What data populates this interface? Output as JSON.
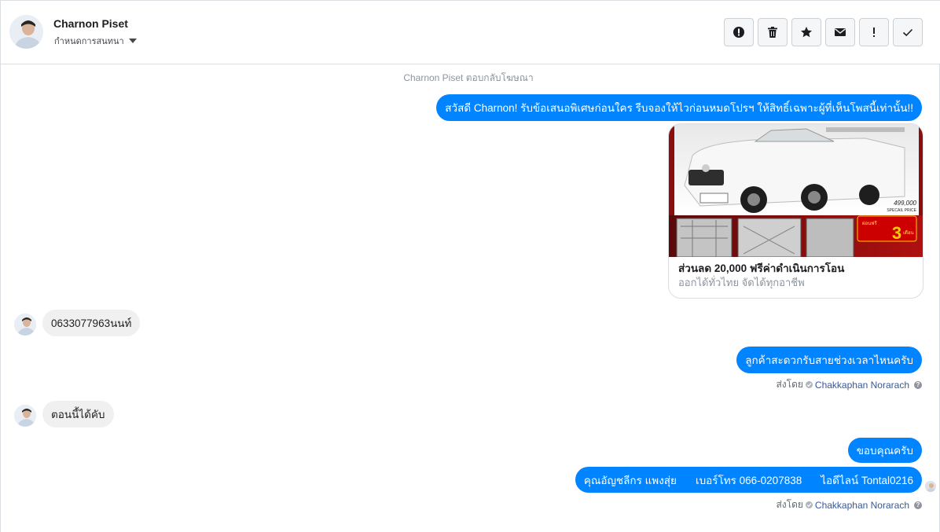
{
  "contact": {
    "name": "Charnon Piset",
    "assign_label": "กำหนดการสนทนา"
  },
  "actions": [
    {
      "icon": "spam-icon"
    },
    {
      "icon": "trash-icon"
    },
    {
      "icon": "star-icon"
    },
    {
      "icon": "mail-icon"
    },
    {
      "icon": "exclamation-icon"
    },
    {
      "icon": "check-icon"
    }
  ],
  "conversation": {
    "system_line": "Charnon Piset ตอบกลับโฆษณา",
    "messages": {
      "greeting": "สวัสดี Charnon! รับข้อเสนอพิเศษก่อนใคร รีบจองให้ไวก่อนหมดโปรฯ ให้สิทธิ์เฉพาะผู้ที่เห็นโพสนี้เท่านั้น!!",
      "ad": {
        "title": "ส่วนลด 20,000 ฟรีค่าดำเนินการโอน",
        "description": "ออกได้ทั่วไทย จัดได้ทุกอาชีพ",
        "price_text": "499,000",
        "price_caption": "SPECAIL PRICE",
        "promo_big": "3",
        "promo_word1": "ผ่อนฟรี",
        "promo_word2": "เดือน"
      },
      "customer_phone": "0633077963นนท์",
      "agent_question": "ลูกค้าสะดวกรับสายช่วงเวลาไหนครับ",
      "customer_reply": "ตอนนี้ได้คับ",
      "agent_thanks": "ขอบคุณครับ",
      "agent_signature": {
        "name": "คุณอัญชลีกร แพงสุ่ย",
        "phone": "เบอร์โทร 066-0207838",
        "line": "ไอดีไลน์ Tontal0216"
      }
    },
    "sent_by": {
      "prefix": "ส่งโดย",
      "agent": "Chakkaphan Norarach"
    }
  },
  "colors": {
    "outgoing": "#0084ff",
    "incoming": "#f0f0f0",
    "link": "#385898"
  }
}
